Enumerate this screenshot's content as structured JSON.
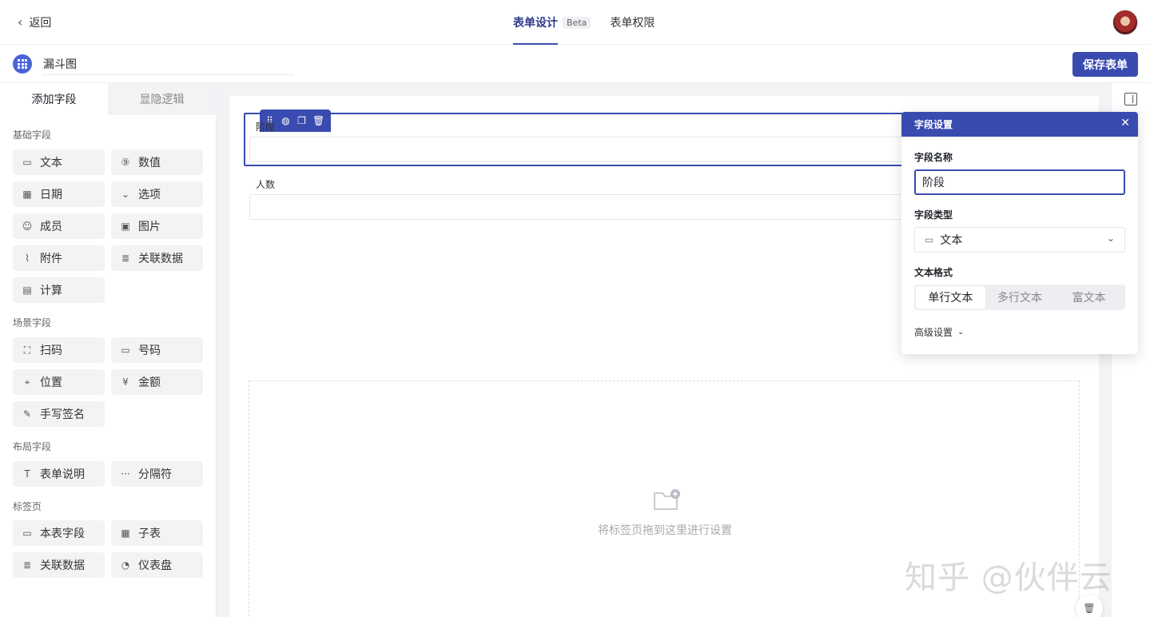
{
  "topbar": {
    "back_label": "返回",
    "tabs": [
      {
        "label": "表单设计",
        "badge": "Beta"
      },
      {
        "label": "表单权限"
      }
    ]
  },
  "subbar": {
    "form_name": "漏斗图",
    "save_label": "保存表单"
  },
  "left_panel": {
    "tabs": [
      "添加字段",
      "显隐逻辑"
    ],
    "groups": [
      {
        "title": "基础字段",
        "items": [
          {
            "label": "文本",
            "icon": "text-field-icon"
          },
          {
            "label": "数值",
            "icon": "number-icon"
          },
          {
            "label": "日期",
            "icon": "calendar-icon"
          },
          {
            "label": "选项",
            "icon": "option-icon"
          },
          {
            "label": "成员",
            "icon": "member-icon"
          },
          {
            "label": "图片",
            "icon": "image-icon"
          },
          {
            "label": "附件",
            "icon": "paperclip-icon"
          },
          {
            "label": "关联数据",
            "icon": "linked-data-icon"
          },
          {
            "label": "计算",
            "icon": "calculator-icon"
          }
        ]
      },
      {
        "title": "场景字段",
        "items": [
          {
            "label": "扫码",
            "icon": "scan-icon"
          },
          {
            "label": "号码",
            "icon": "serial-number-icon"
          },
          {
            "label": "位置",
            "icon": "location-icon"
          },
          {
            "label": "金额",
            "icon": "yen-icon"
          },
          {
            "label": "手写签名",
            "icon": "pen-icon"
          }
        ]
      },
      {
        "title": "布局字段",
        "items": [
          {
            "label": "表单说明",
            "icon": "text-t-icon"
          },
          {
            "label": "分隔符",
            "icon": "ellipsis-icon"
          }
        ]
      },
      {
        "title": "标签页",
        "items": [
          {
            "label": "本表字段",
            "icon": "form-field-icon"
          },
          {
            "label": "子表",
            "icon": "table-icon"
          },
          {
            "label": "关联数据",
            "icon": "linked-data-icon"
          },
          {
            "label": "仪表盘",
            "icon": "dashboard-icon"
          }
        ]
      }
    ]
  },
  "canvas": {
    "fields": [
      {
        "label": "阶段",
        "selected": true
      },
      {
        "label": "人数",
        "selected": false
      }
    ],
    "drop_text": "将标签页拖到这里进行设置"
  },
  "settings": {
    "title": "字段设置",
    "name_label": "字段名称",
    "name_value": "阶段",
    "type_label": "字段类型",
    "type_value": "文本",
    "format_label": "文本格式",
    "format_options": [
      "单行文本",
      "多行文本",
      "富文本"
    ],
    "format_selected": "单行文本",
    "advanced_label": "高级设置"
  },
  "watermark": "知乎 @伙伴云",
  "colors": {
    "accent": "#3a4bb0",
    "canvas_bg": "#f2f3f5",
    "field_btn_bg": "#f2f3f5"
  }
}
